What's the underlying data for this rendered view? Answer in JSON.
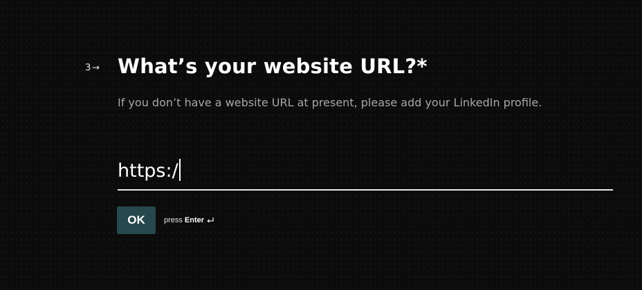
{
  "question": {
    "number": "3",
    "arrow_icon": "arrow-right-icon",
    "title": "What’s your website URL?",
    "required_mark": "*",
    "description": "If you don’t have a website URL at present, please add your LinkedIn profile."
  },
  "url_input": {
    "value": "https:/"
  },
  "actions": {
    "ok_label": "OK",
    "press_label": "press",
    "enter_label": "Enter",
    "enter_icon": "enter-return-icon"
  },
  "colors": {
    "background": "#0b0b0b",
    "accent_button": "#27484c",
    "text_primary": "#ffffff",
    "text_secondary": "#a8a8a8"
  }
}
